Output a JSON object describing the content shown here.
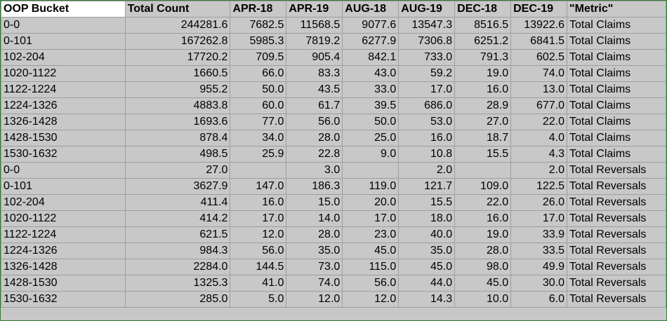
{
  "columns": [
    "OOP Bucket",
    "Total Count",
    "APR-18",
    "APR-19",
    "AUG-18",
    "AUG-19",
    "DEC-18",
    "DEC-19",
    "\"Metric\""
  ],
  "rows": [
    [
      "0-0",
      "244281.6",
      "7682.5",
      "11568.5",
      "9077.6",
      "13547.3",
      "8516.5",
      "13922.6",
      "Total Claims"
    ],
    [
      "0-101",
      "167262.8",
      "5985.3",
      "7819.2",
      "6277.9",
      "7306.8",
      "6251.2",
      "6841.5",
      "Total Claims"
    ],
    [
      "102-204",
      "17720.2",
      "709.5",
      "905.4",
      "842.1",
      "733.0",
      "791.3",
      "602.5",
      "Total Claims"
    ],
    [
      "1020-1122",
      "1660.5",
      "66.0",
      "83.3",
      "43.0",
      "59.2",
      "19.0",
      "74.0",
      "Total Claims"
    ],
    [
      "1122-1224",
      "955.2",
      "50.0",
      "43.5",
      "33.0",
      "17.0",
      "16.0",
      "13.0",
      "Total Claims"
    ],
    [
      "1224-1326",
      "4883.8",
      "60.0",
      "61.7",
      "39.5",
      "686.0",
      "28.9",
      "677.0",
      "Total Claims"
    ],
    [
      "1326-1428",
      "1693.6",
      "77.0",
      "56.0",
      "50.0",
      "53.0",
      "27.0",
      "22.0",
      "Total Claims"
    ],
    [
      "1428-1530",
      "878.4",
      "34.0",
      "28.0",
      "25.0",
      "16.0",
      "18.7",
      "4.0",
      "Total Claims"
    ],
    [
      "1530-1632",
      "498.5",
      "25.9",
      "22.8",
      "9.0",
      "10.8",
      "15.5",
      "4.3",
      "Total Claims"
    ],
    [
      "0-0",
      "27.0",
      "",
      "3.0",
      "",
      "2.0",
      "",
      "2.0",
      "Total Reversals"
    ],
    [
      "0-101",
      "3627.9",
      "147.0",
      "186.3",
      "119.0",
      "121.7",
      "109.0",
      "122.5",
      "Total Reversals"
    ],
    [
      "102-204",
      "411.4",
      "16.0",
      "15.0",
      "20.0",
      "15.5",
      "22.0",
      "26.0",
      "Total Reversals"
    ],
    [
      "1020-1122",
      "414.2",
      "17.0",
      "14.0",
      "17.0",
      "18.0",
      "16.0",
      "17.0",
      "Total Reversals"
    ],
    [
      "1122-1224",
      "621.5",
      "12.0",
      "28.0",
      "23.0",
      "40.0",
      "19.0",
      "33.9",
      "Total Reversals"
    ],
    [
      "1224-1326",
      "984.3",
      "56.0",
      "35.0",
      "45.0",
      "35.0",
      "28.0",
      "33.5",
      "Total Reversals"
    ],
    [
      "1326-1428",
      "2284.0",
      "144.5",
      "73.0",
      "115.0",
      "45.0",
      "98.0",
      "49.9",
      "Total Reversals"
    ],
    [
      "1428-1530",
      "1325.3",
      "41.0",
      "74.0",
      "56.0",
      "44.0",
      "45.0",
      "30.0",
      "Total Reversals"
    ],
    [
      "1530-1632",
      "285.0",
      "5.0",
      "12.0",
      "12.0",
      "14.3",
      "10.0",
      "6.0",
      "Total Reversals"
    ]
  ]
}
